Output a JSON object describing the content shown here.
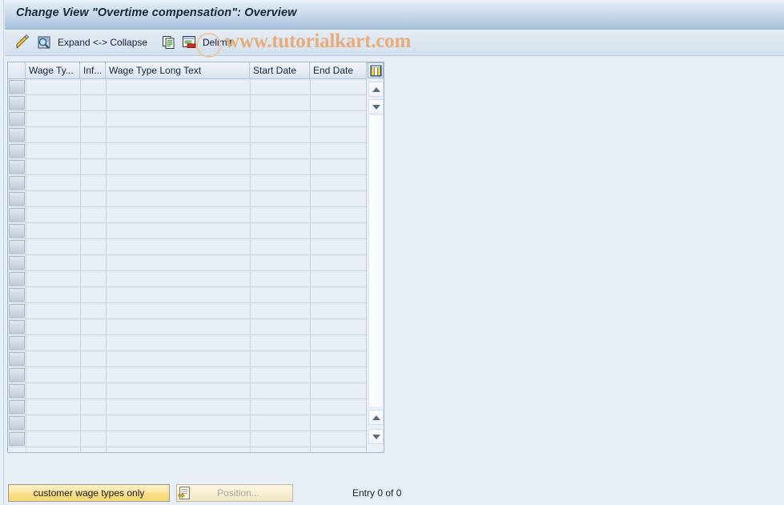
{
  "window": {
    "title": "Change View \"Overtime compensation\": Overview"
  },
  "toolbar": {
    "items": [
      {
        "name": "display-change-icon",
        "label": "",
        "icon": "pencil-icon"
      },
      {
        "name": "details-icon",
        "label": "",
        "icon": "magnifier-document-icon"
      },
      {
        "name": "expand-collapse",
        "label": "Expand <-> Collapse",
        "icon": ""
      },
      {
        "name": "copy-as-icon",
        "label": "",
        "icon": "copy-icon"
      },
      {
        "name": "delimit-icon",
        "label": "",
        "icon": "delimit-icon"
      },
      {
        "name": "delimit",
        "label": "Delimit",
        "icon": ""
      }
    ]
  },
  "watermark": {
    "text": "www.tutorialkart.com"
  },
  "table": {
    "columns": [
      {
        "key": "select",
        "label": ""
      },
      {
        "key": "wage_type",
        "label": "Wage Ty..."
      },
      {
        "key": "infotype",
        "label": "Inf..."
      },
      {
        "key": "long_text",
        "label": "Wage Type Long Text"
      },
      {
        "key": "start_date",
        "label": "Start Date"
      },
      {
        "key": "end_date",
        "label": "End Date"
      }
    ],
    "rows": [],
    "visible_row_count": 23,
    "config_icon": "column-config-icon",
    "scroll": {
      "up_icon": "scroll-up-icon",
      "down_icon": "scroll-down-icon",
      "page_up_icon": "page-up-icon",
      "page_down_icon": "page-down-icon"
    }
  },
  "footer": {
    "customer_wage_types_label": "customer wage types only",
    "position_label": "Position...",
    "position_icon": "position-icon",
    "entry_count": "Entry 0 of 0"
  },
  "colors": {
    "background": "#e8eef6",
    "title_bar_top": "#eaf1f8",
    "title_bar_bottom": "#a7c0da",
    "grid_row": "#e9eff7",
    "grid_line": "#c5d2e0",
    "accent_yellow": "#f6d978",
    "watermark": "#e8ac79"
  }
}
